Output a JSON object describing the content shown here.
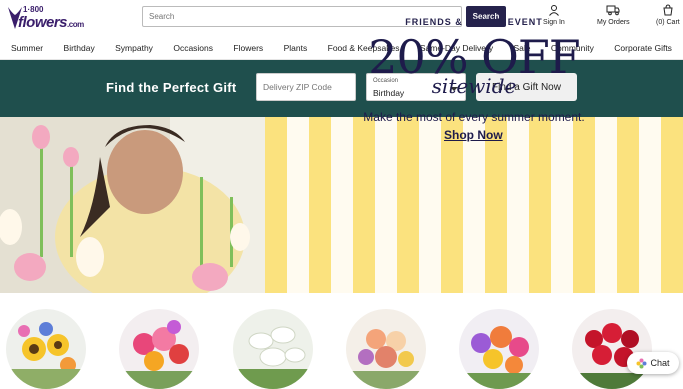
{
  "brand": {
    "line1": "1·800",
    "line2": "flowers",
    "suffix": ".com"
  },
  "search": {
    "placeholder": "Search",
    "button_label": "Search"
  },
  "header_links": [
    {
      "label": "Sign In",
      "icon": "user-icon"
    },
    {
      "label": "My Orders",
      "icon": "truck-icon"
    },
    {
      "label": "(0) Cart",
      "icon": "cart-icon"
    }
  ],
  "nav": [
    "Summer",
    "Birthday",
    "Sympathy",
    "Occasions",
    "Flowers",
    "Plants",
    "Food & Keepsakes",
    "Same-Day Delivery",
    "Sale",
    "Community",
    "Corporate Gifts"
  ],
  "gift_finder": {
    "title": "Find the Perfect Gift",
    "zip_placeholder": "Delivery ZIP Code",
    "occasion_label": "Occasion",
    "occasion_value": "Birthday",
    "button_label": "Find a Gift Now"
  },
  "promo": {
    "kicker": "FRIENDS & FAMILY EVENT",
    "headline": "20% OFF",
    "script": "sitewide",
    "subline": "Make the most of every summer moment.",
    "link": "Shop Now"
  },
  "chat": {
    "label": "Chat"
  },
  "colors": {
    "brand_navy": "#25224c",
    "gift_bar": "#1f4f4d",
    "promo_yellow": "#fbe27e"
  }
}
